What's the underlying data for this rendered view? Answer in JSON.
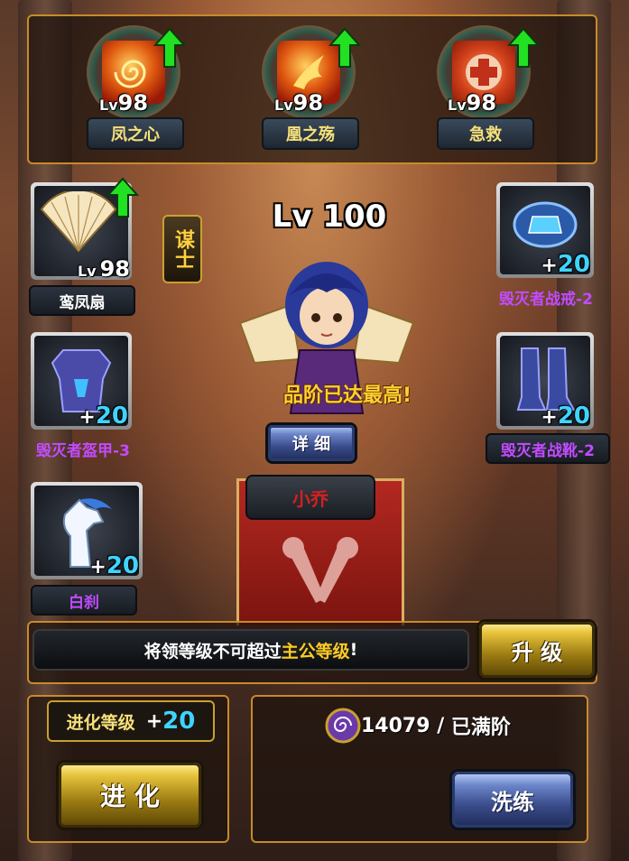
{
  "skills": [
    {
      "level_prefix": "Lv",
      "level": "98",
      "name": "凤之心",
      "icon": "swirl-fire-icon"
    },
    {
      "level_prefix": "Lv",
      "level": "98",
      "name": "凰之殇",
      "icon": "phoenix-icon"
    },
    {
      "level_prefix": "Lv",
      "level": "98",
      "name": "急救",
      "icon": "first-aid-icon"
    }
  ],
  "hero": {
    "level_text": "Lv 100",
    "class_badge": "谋士",
    "quality_msg": "品阶已达最高!",
    "detail_button": "详 细",
    "name": "小乔"
  },
  "weapon": {
    "level_prefix": "Lv",
    "level": "98",
    "name": "鸾凤扇",
    "icon": "fan-icon"
  },
  "equipment_left": [
    {
      "plus": "+",
      "value": "20",
      "name": "毁灭者盔甲-3",
      "icon": "armor-icon"
    },
    {
      "plus": "+",
      "value": "20",
      "name": "白刹",
      "icon": "white-horse-icon"
    }
  ],
  "equipment_right": [
    {
      "plus": "+",
      "value": "20",
      "name": "毁灭者战戒-2",
      "icon": "ring-icon"
    },
    {
      "plus": "+",
      "value": "20",
      "name": "毁灭者战靴-2",
      "icon": "boots-icon"
    }
  ],
  "notice": {
    "prefix": "将领等级不可超过",
    "highlight": "主公等级",
    "suffix": "!"
  },
  "upgrade_button": "升 级",
  "evolve": {
    "label": "进化等级",
    "plus": "+",
    "value": "20",
    "button": "进 化"
  },
  "refine": {
    "value": "14079",
    "separator": " / ",
    "status": "已满阶",
    "button": "洗练",
    "icon": "swirl-orb-icon"
  },
  "colors": {
    "accent_gold": "#f6e07a",
    "equip_blue": "#3fd4ff",
    "equip_purple": "#c24bff",
    "frame_orange": "#c98a2a",
    "highlight_red": "#ffcc22"
  }
}
